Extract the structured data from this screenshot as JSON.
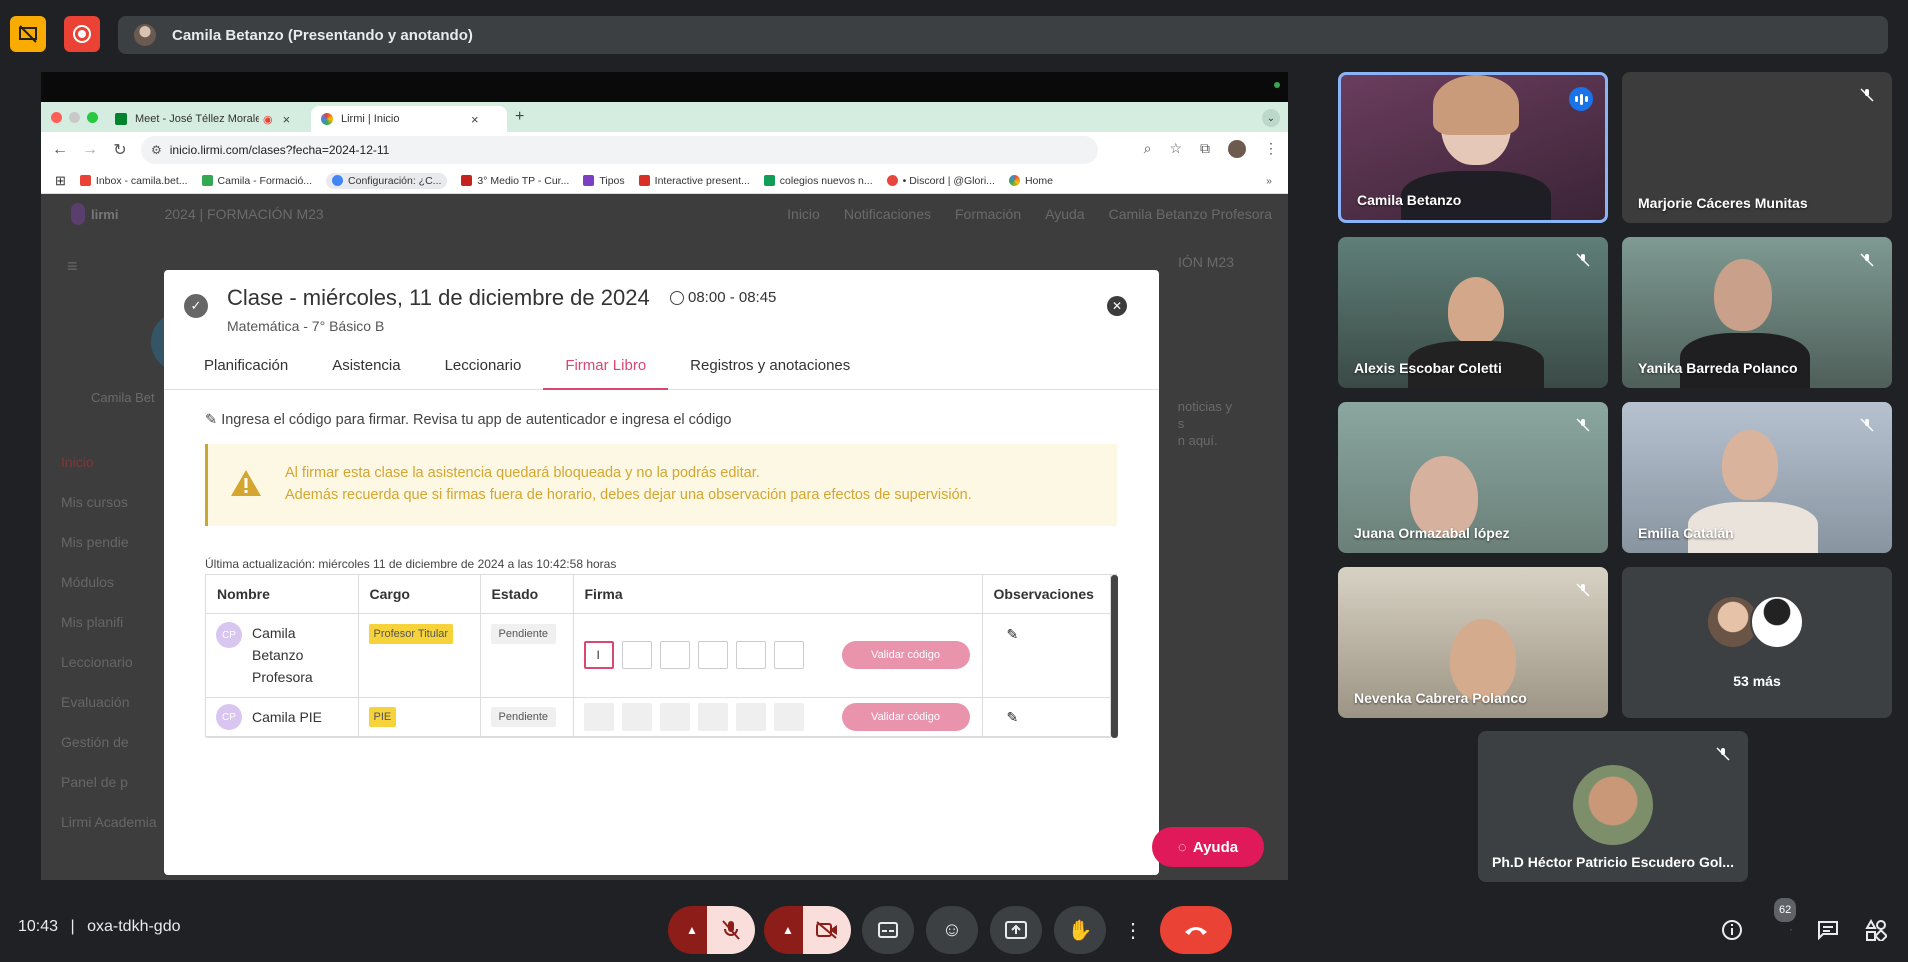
{
  "meet": {
    "presenter_label": "Camila Betanzo (Presentando y anotando)",
    "clock": "10:43",
    "separator": "|",
    "meeting_code": "oxa-tdkh-gdo",
    "participants_count": "62",
    "colors": {
      "background": "#202124",
      "end_call": "#ea4335",
      "accent": "#8ab4f8"
    }
  },
  "browser": {
    "tabs": [
      {
        "label": "Meet - José Téllez Morale"
      },
      {
        "label": "Lirmi | Inicio"
      }
    ],
    "url": "inicio.lirmi.com/clases?fecha=2024-12-11",
    "bookmarks": [
      "Inbox - camila.bet...",
      "Camila - Formació...",
      "Configuración: ¿C...",
      "3° Medio TP - Cur...",
      "Tipos",
      "Interactive present...",
      "colegios nuevos n...",
      "• Discord | @Glori...",
      "Home"
    ]
  },
  "lirmi": {
    "logo": "lirmi",
    "year_section": "2024  |  FORMACIÓN M23",
    "nav": [
      "Inicio",
      "Notificaciones",
      "Formación",
      "Ayuda",
      "Camila Betanzo Profesora"
    ],
    "user_name": "Camila Bet",
    "section_right": "IÓN M23",
    "news_text": [
      "noticias y",
      "s",
      "n aquí."
    ],
    "sidebar": [
      "Inicio",
      "Mis cursos",
      "Mis pendie",
      "Módulos",
      "Mis planifi",
      "Leccionario",
      "Evaluación",
      "Gestión de",
      "Panel de p",
      "Lirmi Academia"
    ]
  },
  "modal": {
    "title": "Clase - miércoles, 11 de diciembre de 2024",
    "time": "08:00 - 08:45",
    "subtitle": "Matemática - 7° Básico B",
    "tabs": [
      "Planificación",
      "Asistencia",
      "Leccionario",
      "Firmar Libro",
      "Registros y anotaciones"
    ],
    "instruction": "Ingresa el código para firmar. Revisa tu app de autenticador e ingresa el código",
    "alert_line1": "Al firmar esta clase la asistencia quedará bloqueada y no la podrás editar.",
    "alert_line2": "Además recuerda que si firmas fuera de horario, debes dejar una observación para efectos de supervisión.",
    "last_update": "Última actualización: miércoles 11 de diciembre de 2024 a las 10:42:58 horas",
    "columns": [
      "Nombre",
      "Cargo",
      "Estado",
      "Firma",
      "Observaciones"
    ],
    "rows": [
      {
        "initials": "CP",
        "name": "Camila Betanzo Profesora",
        "role": "Profesor Titular",
        "status": "Pendiente",
        "button": "Validar código"
      },
      {
        "initials": "CP",
        "name": "Camila PIE",
        "role": "PIE",
        "status": "Pendiente",
        "button": "Validar código"
      }
    ],
    "help_button": "Ayuda",
    "colors": {
      "accent": "#d94870",
      "alert_text": "#d4a630",
      "role_badge": "#f6d33a"
    }
  },
  "participants": [
    {
      "name": "Camila Betanzo"
    },
    {
      "name": "Marjorie Cáceres Munitas"
    },
    {
      "name": "Alexis Escobar Coletti"
    },
    {
      "name": "Yanika Barreda Polanco"
    },
    {
      "name": "Juana Ormazabal lópez"
    },
    {
      "name": "Emilia Catalán"
    },
    {
      "name": "Nevenka Cabrera Polanco"
    },
    {
      "name": "53 más"
    },
    {
      "name": "Ph.D Héctor Patricio Escudero Gol..."
    }
  ]
}
